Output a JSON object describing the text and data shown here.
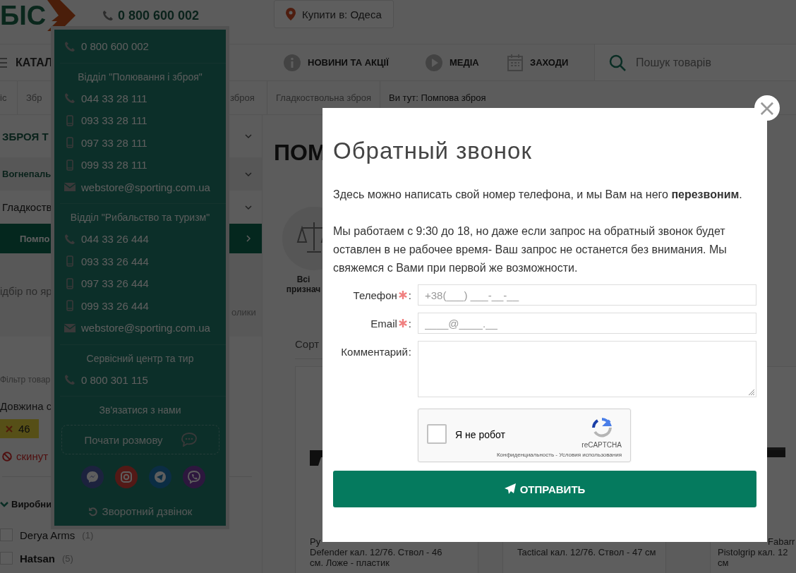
{
  "header": {
    "logo": "БІС",
    "phone": "0 800 600 002",
    "location_button": "Купити в: Одеса"
  },
  "nav": {
    "catalog": "КАТАЛ",
    "items": [
      {
        "label": "НОВИНИ ТА АКЦІЇ",
        "kind": "info"
      },
      {
        "label": "МЕДІА",
        "kind": "play"
      },
      {
        "label": "ЗАХОДИ",
        "kind": "calendar"
      }
    ],
    "search": {
      "placeholder": "Пошук товарів"
    }
  },
  "breadcrumbs": [
    {
      "label": "іс",
      "current": false
    },
    {
      "label": "Збр",
      "current": false
    },
    {
      "label": "зброя",
      "current": false
    },
    {
      "label": "Гладкоствольна зброя",
      "current": false
    },
    {
      "label": "Ви тут: Помпова зброя",
      "current": true
    }
  ],
  "sidebar": {
    "categories": [
      {
        "label": "ЗБРОЯ Т",
        "kind": "section",
        "selected": false
      },
      {
        "label": "Вогнепаль",
        "kind": "group",
        "selected": false
      },
      {
        "label": "Гладкоств",
        "kind": "item",
        "selected": false
      },
      {
        "label": "Помпо",
        "kind": "item",
        "selected": true
      }
    ],
    "selection_left": "ідбір по яр",
    "selection_right": "олики",
    "filter_caption": "Фільтр товар",
    "filter_name": "Довжина с",
    "active_tag": "46",
    "reset": "скинут",
    "manufacturer_heading": "Виробни",
    "manufacturers": [
      {
        "name": "Derya Arms",
        "count": "(1)",
        "checked": false,
        "emphasized": false
      },
      {
        "name": "Hatsan",
        "count": "(5)",
        "checked": false,
        "emphasized": true
      }
    ]
  },
  "main": {
    "title": "ПОМ",
    "category_lines": [
      "Всі",
      "признач"
    ],
    "sort_label": "Сорт",
    "products": [
      {
        "kind": "picture",
        "lines": [
          "Ру",
          "Defender кал. 12/76. Ствол - 46",
          "см. Ложе - пластик"
        ]
      },
      {
        "lines": [
          "Tactical кал. 12/76. Ствол - 47 см"
        ]
      },
      {
        "kind": "picture",
        "lines": [
          "Fabarr",
          "Pistolgrip кал. 12",
          "см"
        ]
      }
    ]
  },
  "contacts_menu": {
    "sections": [
      {
        "entries": [
          {
            "kind": "phone",
            "text": "0 800 600 002"
          }
        ]
      },
      {
        "heading": "Відділ \"Полювання і зброя\"",
        "entries": [
          {
            "kind": "phone",
            "text": "044 33 28 111"
          },
          {
            "kind": "mobile",
            "text": "093 33 28 111"
          },
          {
            "kind": "mobile",
            "text": "097 33 28 111"
          },
          {
            "kind": "mobile",
            "text": "099 33 28 111"
          },
          {
            "kind": "email",
            "text": "webstore@sporting.com.ua"
          }
        ]
      },
      {
        "heading": "Відділ \"Рибальство та туризм\"",
        "entries": [
          {
            "kind": "phone",
            "text": "044 33 26 444"
          },
          {
            "kind": "mobile",
            "text": "093 33 26 444"
          },
          {
            "kind": "mobile",
            "text": "097 33 26 444"
          },
          {
            "kind": "mobile",
            "text": "099 33 26 444"
          },
          {
            "kind": "email",
            "text": "webstore@sporting.com.ua"
          }
        ]
      },
      {
        "heading": "Сервісний центр та тир",
        "entries": [
          {
            "kind": "phone",
            "text": "0 800 301 115"
          }
        ]
      }
    ],
    "contact_heading": "Зв'язатися з нами",
    "chat_button": "Почати розмову",
    "socials": [
      {
        "kind": "messenger"
      },
      {
        "kind": "instagram"
      },
      {
        "kind": "telegram"
      },
      {
        "kind": "viber"
      }
    ],
    "callback_link": "Зворотний дзвінок"
  },
  "modal": {
    "close": "×",
    "title": "Обратный звонок",
    "intro": "Здесь можно написать свой номер телефона, и мы Вам на него **перезвоним**.",
    "notice": "Мы работаем с 9:30 до 18, но даже если запрос на обратный звонок будет оставлен в не рабочее время- Ваш запрос не останется без внимания. Мы свяжемся с Вами при первой же возможности.",
    "fields": [
      {
        "kind": "input",
        "label": "Телефон",
        "required": true,
        "suffix": ":",
        "placeholder": "+38(___) ___-__-__"
      },
      {
        "kind": "input",
        "label": "Email",
        "required": true,
        "suffix": ":",
        "placeholder": "____@____.__"
      },
      {
        "kind": "textarea",
        "label": "Комментарий",
        "required": false,
        "suffix": ":"
      }
    ],
    "captcha": {
      "label": "Я не робот",
      "checked": false,
      "brand": "reCAPTCHA",
      "links": "Конфиденциальность - Условия использования"
    },
    "submit": "ОТПРАВИТЬ"
  }
}
